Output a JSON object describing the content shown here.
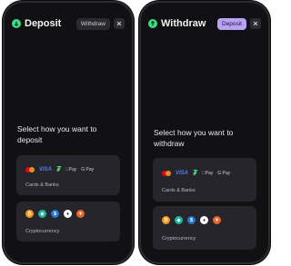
{
  "left": {
    "title": "Deposit",
    "switch_label": "Withdraw",
    "prompt": "Select how you want to deposit",
    "cards_label": "Cards & Banks",
    "crypto_label": "Cryptocurrency",
    "visa": "VISA",
    "apple_pay": "Pay",
    "google_pay": "G Pay"
  },
  "right": {
    "title": "Withdraw",
    "switch_label": "Deposit",
    "prompt": "Select how you want to withdraw",
    "cards_label": "Cards & Banks",
    "crypto_label": "Cryptocurrency",
    "visa": "VISA",
    "apple_pay": "Pay",
    "google_pay": "G Pay"
  },
  "colors": {
    "brand": "#3ddc84",
    "accent": "#b9a2f4",
    "background": "#111114",
    "card": "#25252b"
  },
  "icons": [
    "close-icon",
    "mastercard-icon",
    "tether-icon",
    "bitcoin-icon",
    "diamond-icon",
    "usdc-icon",
    "ethereum-icon",
    "shiba-icon"
  ]
}
